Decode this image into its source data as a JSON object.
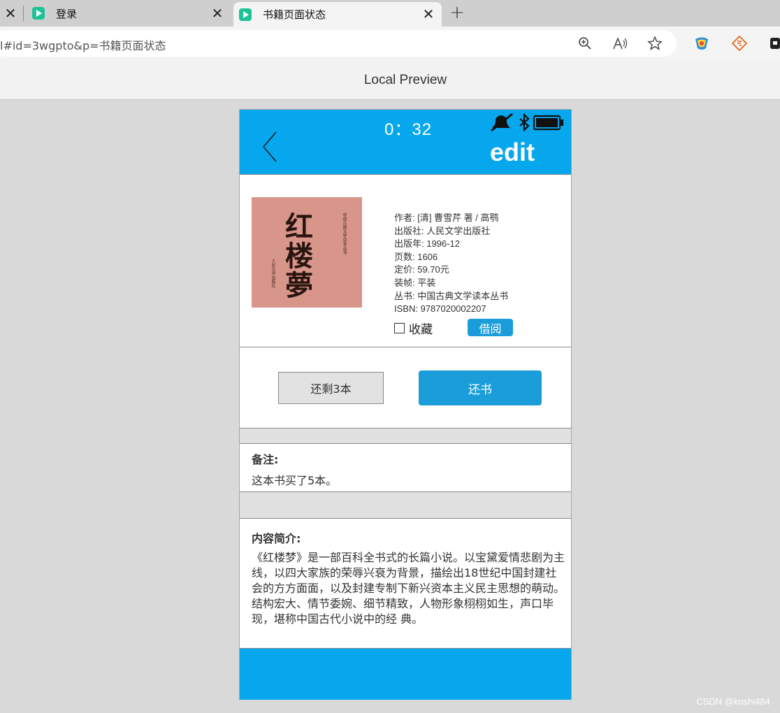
{
  "browser": {
    "tabs": [
      {
        "title": "登录",
        "active": false
      },
      {
        "title": "书籍页面状态",
        "active": true
      }
    ],
    "url": "l#id=3wgpto&p=书籍页面状态",
    "icons": [
      "close-icon",
      "zoom-icon",
      "read-aloud-icon",
      "favorite-star-icon",
      "extension-icon",
      "new-tab-icon"
    ]
  },
  "preview": {
    "title": "Local Preview"
  },
  "app": {
    "header": {
      "time": "0：32",
      "title": "edit"
    },
    "book": {
      "cover_title_chars": [
        "红",
        "楼",
        "夢"
      ],
      "cover_series": "中国古典文学读本丛书",
      "cover_publisher": "人民文学出版社",
      "info": [
        "作者: [清] 曹雪芹 著 / 高鹗",
        "出版社: 人民文学出版社",
        "出版年: 1996-12",
        "页数: 1606",
        "定价: 59.70元",
        "装帧: 平装",
        "丛书: 中国古典文学读本丛书",
        "ISBN: 9787020002207"
      ],
      "favorite_label": "收藏",
      "favorite_checked": false,
      "borrow_label": "借阅"
    },
    "actions": {
      "remain_label": "还剩3本",
      "return_label": "还书"
    },
    "note": {
      "heading": "备注:",
      "body": "这本书买了5本。"
    },
    "intro": {
      "heading": "内容简介:",
      "body": "《红楼梦》是一部百科全书式的长篇小说。以宝黛爱情悲剧为主线，以四大家族的荣辱兴衰为背景，描绘出18世纪中国封建社会的方方面面，以及封建专制下新兴资本主义民主思想的萌动。结构宏大、情节委婉、细节精致，人物形象栩栩如生，声口毕现，堪称中国古代小说中的经 典。"
    },
    "colors": {
      "header_blue": "#06a7ec",
      "button_blue": "#1a9dd9"
    }
  },
  "watermark": "CSDN @koshi484"
}
